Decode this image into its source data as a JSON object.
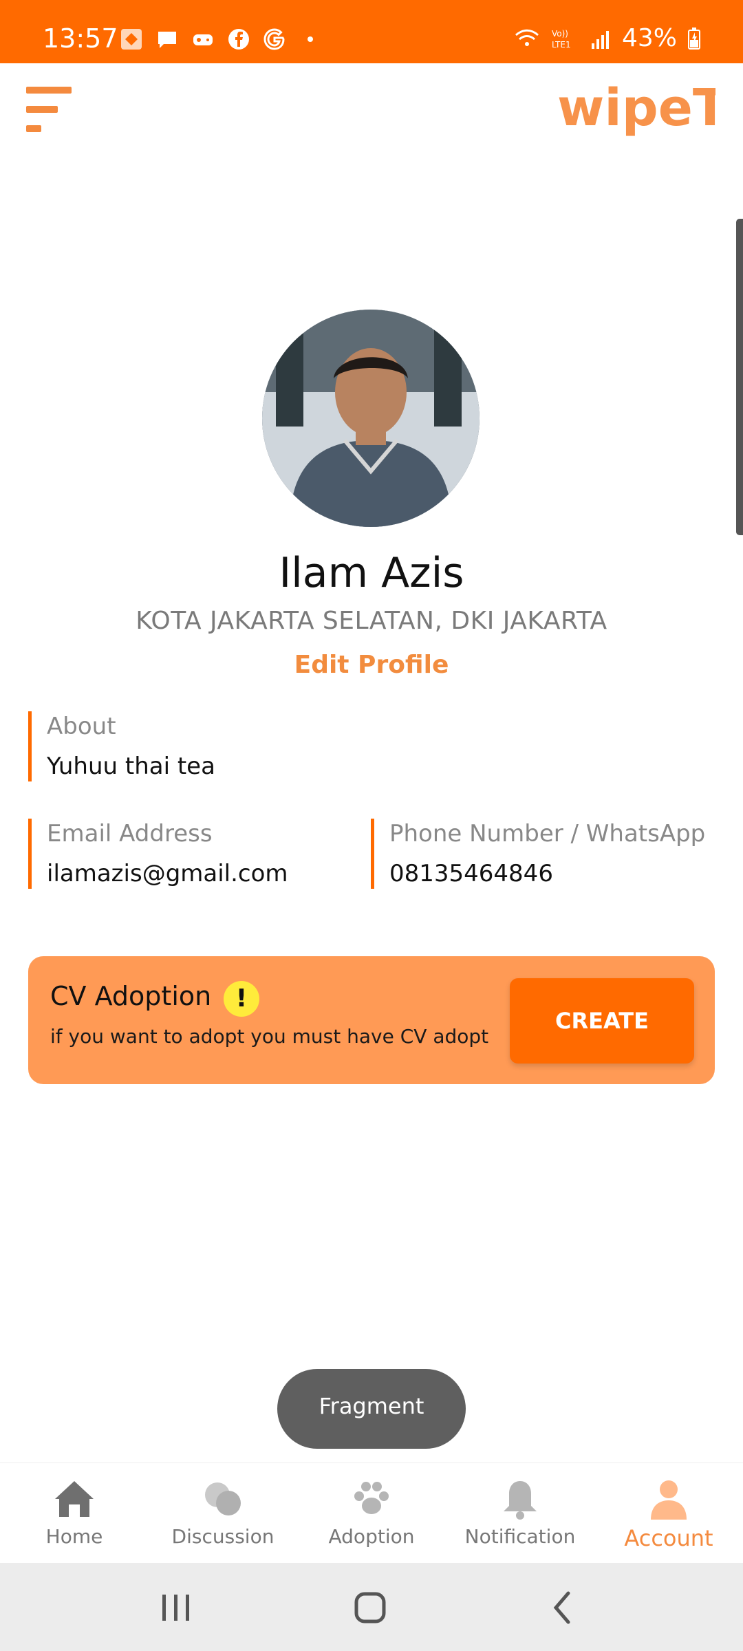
{
  "status_bar": {
    "time": "13:57",
    "battery": "43%",
    "icons": [
      "app-icon",
      "message-icon",
      "game-icon",
      "facebook-icon",
      "google-icon",
      "dot-icon"
    ],
    "right_icons": [
      "wifi-icon",
      "volte-icon",
      "signal-icon",
      "battery-icon"
    ]
  },
  "header": {
    "logo_text": "wipeT",
    "menu_icon": "menu-icon"
  },
  "profile": {
    "name": "Ilam Azis",
    "location": "KOTA JAKARTA SELATAN,  DKI JAKARTA",
    "edit_label": "Edit Profile",
    "about_label": "About",
    "about_value": "Yuhuu thai tea",
    "email_label": "Email Address",
    "email_value": "ilamazis@gmail.com",
    "phone_label": "Phone Number / WhatsApp",
    "phone_value": "08135464846"
  },
  "cv_card": {
    "title": "CV Adoption",
    "warn_symbol": "!",
    "subtitle": "if you want to adopt you must have CV adopt",
    "button_label": "CREATE"
  },
  "toast": {
    "text": "Fragment"
  },
  "bottom_nav": {
    "items": [
      {
        "label": "Home",
        "icon": "home-icon"
      },
      {
        "label": "Discussion",
        "icon": "chat-icon"
      },
      {
        "label": "Adoption",
        "icon": "paw-icon"
      },
      {
        "label": "Notification",
        "icon": "bell-icon"
      },
      {
        "label": "Account",
        "icon": "person-icon"
      }
    ],
    "active": "Account"
  },
  "colors": {
    "accent": "#ff6a00",
    "card": "#ff9a55",
    "active_nav": "#f48a3e"
  }
}
